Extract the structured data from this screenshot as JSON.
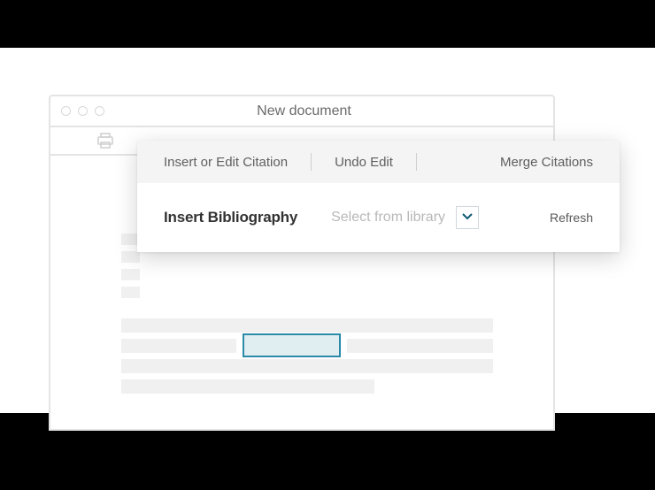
{
  "window": {
    "title": "New document"
  },
  "toolbar": {
    "insert_edit": "Insert or Edit Citation",
    "undo": "Undo Edit",
    "merge": "Merge Citations",
    "bibliography": "Insert Bibliography",
    "select_from_library": "Select from library",
    "refresh": "Refresh"
  }
}
